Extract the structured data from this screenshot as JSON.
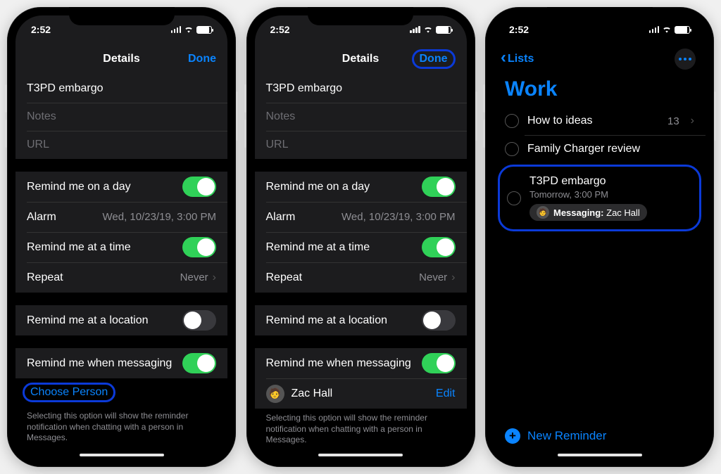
{
  "time": "2:52",
  "phone1": {
    "title": "Details",
    "done": "Done",
    "reminder_title": "T3PD embargo",
    "notes_ph": "Notes",
    "url_ph": "URL",
    "remind_day": "Remind me on a day",
    "alarm_label": "Alarm",
    "alarm_value": "Wed, 10/23/19, 3:00 PM",
    "remind_time": "Remind me at a time",
    "repeat_label": "Repeat",
    "repeat_value": "Never",
    "remind_loc": "Remind me at a location",
    "remind_msg": "Remind me when messaging",
    "choose_person": "Choose Person",
    "help": "Selecting this option will show the reminder notification when chatting with a person in Messages."
  },
  "phone2": {
    "title": "Details",
    "done": "Done",
    "reminder_title": "T3PD embargo",
    "notes_ph": "Notes",
    "url_ph": "URL",
    "remind_day": "Remind me on a day",
    "alarm_label": "Alarm",
    "alarm_value": "Wed, 10/23/19, 3:00 PM",
    "remind_time": "Remind me at a time",
    "repeat_label": "Repeat",
    "repeat_value": "Never",
    "remind_loc": "Remind me at a location",
    "remind_msg": "Remind me when messaging",
    "person_name": "Zac Hall",
    "edit": "Edit",
    "help": "Selecting this option will show the reminder notification when chatting with a person in Messages."
  },
  "phone3": {
    "back": "Lists",
    "title": "Work",
    "items": [
      {
        "title": "How to ideas",
        "count": "13"
      },
      {
        "title": "Family Charger review"
      },
      {
        "title": "T3PD embargo",
        "sub": "Tomorrow, 3:00 PM",
        "msg_label": "Messaging:",
        "msg_name": "Zac Hall"
      }
    ],
    "new_reminder": "New Reminder"
  }
}
